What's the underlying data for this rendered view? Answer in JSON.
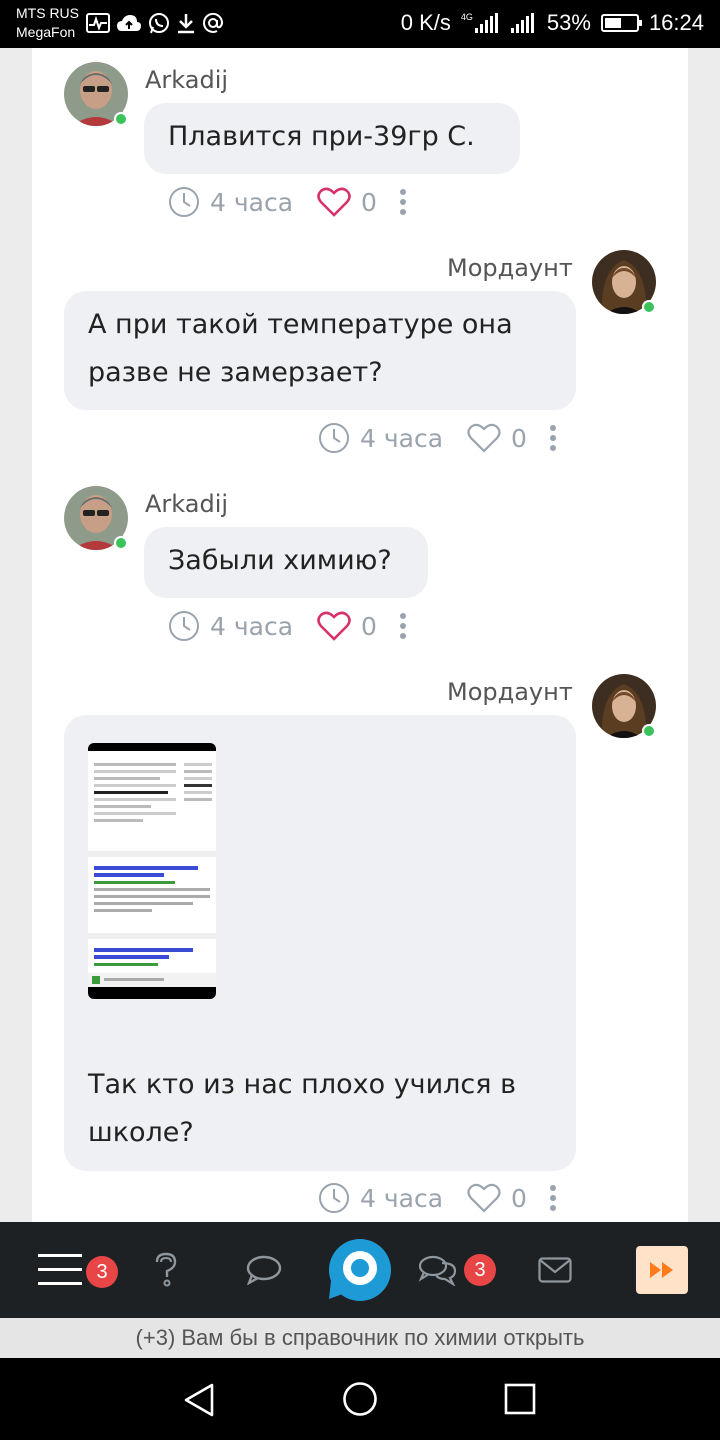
{
  "status_bar": {
    "carrier_line1": "MTS RUS",
    "carrier_line2": "MegaFon",
    "net_speed": "0 K/s",
    "net_type": "4G",
    "battery": "53%",
    "battery_level": 0.53,
    "time": "16:24"
  },
  "messages": [
    {
      "author": "Arkadij",
      "text": "Плавится при-39гр С.",
      "time": "4 часа",
      "likes": "0",
      "side": "left"
    },
    {
      "author": "Мордаунт",
      "text": "А при такой температуре она разве не замерзает?",
      "time": "4 часа",
      "likes": "0",
      "side": "right"
    },
    {
      "author": "Arkadij",
      "text": "Забыли химию?",
      "time": "4 часа",
      "likes": "0",
      "side": "left"
    },
    {
      "author": "Мордаунт",
      "text": "Так кто из нас плохо учился в школе?",
      "time": "4 часа",
      "likes": "0",
      "side": "right",
      "has_image": true
    }
  ],
  "nav": {
    "menu_badge": "3",
    "chats_badge": "3"
  },
  "notice": "(+3) Вам бы в справочник по химии открыть",
  "colors": {
    "online": "#3bc35b",
    "heart_active": "#d6336c",
    "badge": "#e84646",
    "logo": "#1e9bd7",
    "forward_button": "#ffe2c7",
    "forward_icon": "#ff7a1a"
  }
}
